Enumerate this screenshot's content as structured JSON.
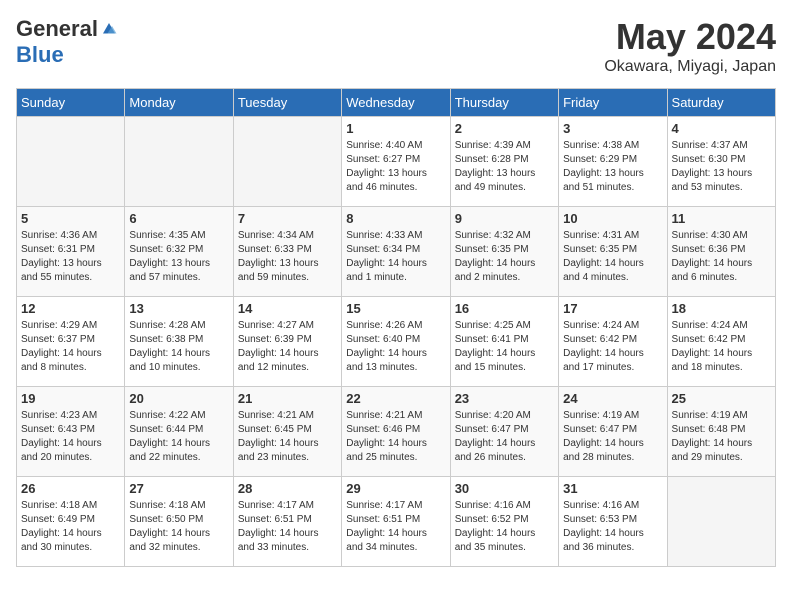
{
  "logo": {
    "general": "General",
    "blue": "Blue"
  },
  "title": "May 2024",
  "location": "Okawara, Miyagi, Japan",
  "days_of_week": [
    "Sunday",
    "Monday",
    "Tuesday",
    "Wednesday",
    "Thursday",
    "Friday",
    "Saturday"
  ],
  "weeks": [
    [
      {
        "day": "",
        "info": ""
      },
      {
        "day": "",
        "info": ""
      },
      {
        "day": "",
        "info": ""
      },
      {
        "day": "1",
        "info": "Sunrise: 4:40 AM\nSunset: 6:27 PM\nDaylight: 13 hours\nand 46 minutes."
      },
      {
        "day": "2",
        "info": "Sunrise: 4:39 AM\nSunset: 6:28 PM\nDaylight: 13 hours\nand 49 minutes."
      },
      {
        "day": "3",
        "info": "Sunrise: 4:38 AM\nSunset: 6:29 PM\nDaylight: 13 hours\nand 51 minutes."
      },
      {
        "day": "4",
        "info": "Sunrise: 4:37 AM\nSunset: 6:30 PM\nDaylight: 13 hours\nand 53 minutes."
      }
    ],
    [
      {
        "day": "5",
        "info": "Sunrise: 4:36 AM\nSunset: 6:31 PM\nDaylight: 13 hours\nand 55 minutes."
      },
      {
        "day": "6",
        "info": "Sunrise: 4:35 AM\nSunset: 6:32 PM\nDaylight: 13 hours\nand 57 minutes."
      },
      {
        "day": "7",
        "info": "Sunrise: 4:34 AM\nSunset: 6:33 PM\nDaylight: 13 hours\nand 59 minutes."
      },
      {
        "day": "8",
        "info": "Sunrise: 4:33 AM\nSunset: 6:34 PM\nDaylight: 14 hours\nand 1 minute."
      },
      {
        "day": "9",
        "info": "Sunrise: 4:32 AM\nSunset: 6:35 PM\nDaylight: 14 hours\nand 2 minutes."
      },
      {
        "day": "10",
        "info": "Sunrise: 4:31 AM\nSunset: 6:35 PM\nDaylight: 14 hours\nand 4 minutes."
      },
      {
        "day": "11",
        "info": "Sunrise: 4:30 AM\nSunset: 6:36 PM\nDaylight: 14 hours\nand 6 minutes."
      }
    ],
    [
      {
        "day": "12",
        "info": "Sunrise: 4:29 AM\nSunset: 6:37 PM\nDaylight: 14 hours\nand 8 minutes."
      },
      {
        "day": "13",
        "info": "Sunrise: 4:28 AM\nSunset: 6:38 PM\nDaylight: 14 hours\nand 10 minutes."
      },
      {
        "day": "14",
        "info": "Sunrise: 4:27 AM\nSunset: 6:39 PM\nDaylight: 14 hours\nand 12 minutes."
      },
      {
        "day": "15",
        "info": "Sunrise: 4:26 AM\nSunset: 6:40 PM\nDaylight: 14 hours\nand 13 minutes."
      },
      {
        "day": "16",
        "info": "Sunrise: 4:25 AM\nSunset: 6:41 PM\nDaylight: 14 hours\nand 15 minutes."
      },
      {
        "day": "17",
        "info": "Sunrise: 4:24 AM\nSunset: 6:42 PM\nDaylight: 14 hours\nand 17 minutes."
      },
      {
        "day": "18",
        "info": "Sunrise: 4:24 AM\nSunset: 6:42 PM\nDaylight: 14 hours\nand 18 minutes."
      }
    ],
    [
      {
        "day": "19",
        "info": "Sunrise: 4:23 AM\nSunset: 6:43 PM\nDaylight: 14 hours\nand 20 minutes."
      },
      {
        "day": "20",
        "info": "Sunrise: 4:22 AM\nSunset: 6:44 PM\nDaylight: 14 hours\nand 22 minutes."
      },
      {
        "day": "21",
        "info": "Sunrise: 4:21 AM\nSunset: 6:45 PM\nDaylight: 14 hours\nand 23 minutes."
      },
      {
        "day": "22",
        "info": "Sunrise: 4:21 AM\nSunset: 6:46 PM\nDaylight: 14 hours\nand 25 minutes."
      },
      {
        "day": "23",
        "info": "Sunrise: 4:20 AM\nSunset: 6:47 PM\nDaylight: 14 hours\nand 26 minutes."
      },
      {
        "day": "24",
        "info": "Sunrise: 4:19 AM\nSunset: 6:47 PM\nDaylight: 14 hours\nand 28 minutes."
      },
      {
        "day": "25",
        "info": "Sunrise: 4:19 AM\nSunset: 6:48 PM\nDaylight: 14 hours\nand 29 minutes."
      }
    ],
    [
      {
        "day": "26",
        "info": "Sunrise: 4:18 AM\nSunset: 6:49 PM\nDaylight: 14 hours\nand 30 minutes."
      },
      {
        "day": "27",
        "info": "Sunrise: 4:18 AM\nSunset: 6:50 PM\nDaylight: 14 hours\nand 32 minutes."
      },
      {
        "day": "28",
        "info": "Sunrise: 4:17 AM\nSunset: 6:51 PM\nDaylight: 14 hours\nand 33 minutes."
      },
      {
        "day": "29",
        "info": "Sunrise: 4:17 AM\nSunset: 6:51 PM\nDaylight: 14 hours\nand 34 minutes."
      },
      {
        "day": "30",
        "info": "Sunrise: 4:16 AM\nSunset: 6:52 PM\nDaylight: 14 hours\nand 35 minutes."
      },
      {
        "day": "31",
        "info": "Sunrise: 4:16 AM\nSunset: 6:53 PM\nDaylight: 14 hours\nand 36 minutes."
      },
      {
        "day": "",
        "info": ""
      }
    ]
  ]
}
